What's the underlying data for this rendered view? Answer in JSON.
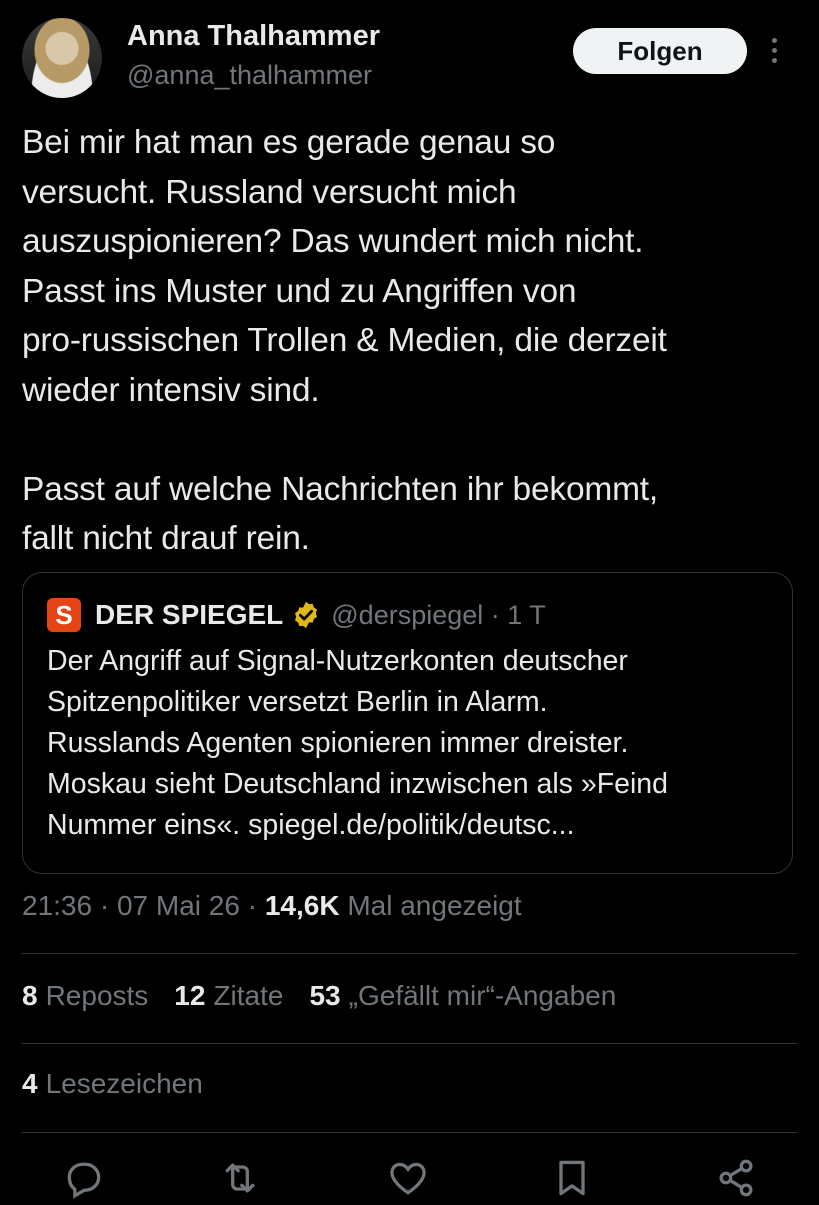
{
  "author": {
    "name": "Anna Thalhammer",
    "handle": "@anna_thalhammer",
    "follow_label": "Folgen"
  },
  "tweet": {
    "text": "Bei mir hat man es gerade genau so\nversucht. Russland versucht mich\nauszuspionieren? Das wundert mich nicht.\nPasst ins Muster und zu Angriffen von\npro-russischen Trollen & Medien, die derzeit\nwieder intensiv sind.\n\nPasst auf welche Nachrichten ihr bekommt,\nfallt nicht drauf rein."
  },
  "quote": {
    "logo_letter": "S",
    "name": "DER SPIEGEL",
    "handle_time": "@derspiegel · 1 T",
    "text": "Der Angriff auf Signal-Nutzerkonten deutscher\nSpitzenpolitiker versetzt Berlin in Alarm.\nRusslands Agenten spionieren immer dreister.\nMoskau sieht Deutschland inzwischen als »Feind\nNummer eins«. spiegel.de/politik/deutsc..."
  },
  "meta": {
    "time": "21:36",
    "date": "07 Mai 26",
    "views": "14,6K",
    "views_label": "Mal angezeigt"
  },
  "stats": {
    "reposts_count": "8",
    "reposts_label": "Reposts",
    "quotes_count": "12",
    "quotes_label": "Zitate",
    "likes_count": "53",
    "likes_label": "„Gefällt mir“-Angaben",
    "bookmarks_count": "4",
    "bookmarks_label": "Lesezeichen"
  },
  "actions": [
    "reply-icon",
    "repost-icon",
    "like-icon",
    "bookmark-icon",
    "share-icon"
  ],
  "colors": {
    "background": "#000000",
    "text": "#e7e9ea",
    "muted": "#71767b",
    "border": "#2f3336",
    "verified_gold": "#e2b719",
    "spiegel_orange": "#e64415"
  }
}
